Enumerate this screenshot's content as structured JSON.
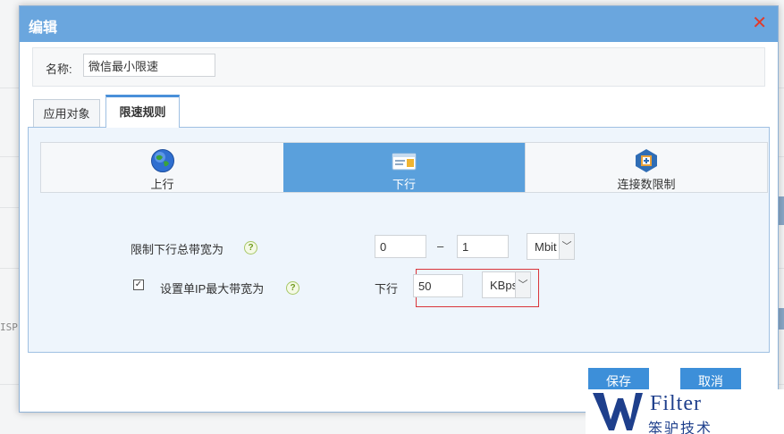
{
  "background": {
    "fragment_text": "ISP"
  },
  "dialog": {
    "title": "编辑",
    "close_symbol": "✕",
    "name_label": "名称:",
    "name_value": "微信最小限速"
  },
  "tabs": [
    {
      "label": "应用对象",
      "active": false
    },
    {
      "label": "限速规则",
      "active": true
    }
  ],
  "subtabs": [
    {
      "label": "上行",
      "icon": "globe-icon",
      "active": false
    },
    {
      "label": "下行",
      "icon": "download-card-icon",
      "active": true
    },
    {
      "label": "连接数限制",
      "icon": "connection-limit-icon",
      "active": false
    }
  ],
  "total_bandwidth": {
    "label": "限制下行总带宽为",
    "help": "?",
    "min_value": "0",
    "separator": "–",
    "max_value": "1",
    "unit": "Mbit"
  },
  "per_ip": {
    "checked": true,
    "checkbox_mark": "✓",
    "label": "设置单IP最大带宽为",
    "help": "?",
    "direction_label": "下行",
    "value": "50",
    "unit": "KBps"
  },
  "buttons": {
    "save": "保存",
    "cancel": "取消"
  },
  "watermark": {
    "letter": "W",
    "english": "Filter",
    "chinese": "笨驴技术"
  },
  "colors": {
    "header": "#6aa6de",
    "active_subtab": "#5aa0dc",
    "button": "#3d8fd9",
    "highlight": "#d9353b"
  }
}
